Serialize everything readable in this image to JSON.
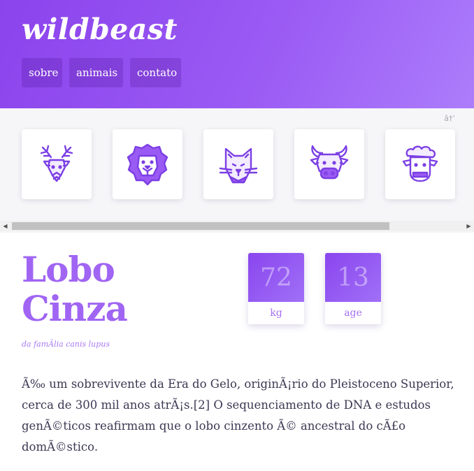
{
  "header": {
    "logo": "wildbeast",
    "nav": [
      "sobre",
      "animais",
      "contato"
    ]
  },
  "gallery": {
    "note": "â†’",
    "animals": [
      "deer-icon",
      "lion-icon",
      "cat-icon",
      "bull-icon",
      "sheep-icon"
    ]
  },
  "scrollbar": {
    "left_arrow": "◀",
    "right_arrow": "▶"
  },
  "animal": {
    "name_line1": "Lobo",
    "name_line2": "Cinza",
    "family": "da famÃlia canis lupus",
    "weight_value": "72",
    "weight_label": "kg",
    "age_value": "13",
    "age_label": "age",
    "description": "Ã‰ um sobrevivente da Era do Gelo, originÃ¡rio do Pleistoceno Superior, cerca de 300 mil anos atrÃ¡s.[2] O sequenciamento de DNA e estudos genÃ©ticos reafirmam que o lobo cinzento Ã© ancestral do cÃ£o domÃ©stico."
  },
  "colors": {
    "accent": "#8b43ec",
    "accent_light": "#ac7dfb",
    "title": "#a065f3",
    "icon_stroke": "#7b3fe4"
  }
}
